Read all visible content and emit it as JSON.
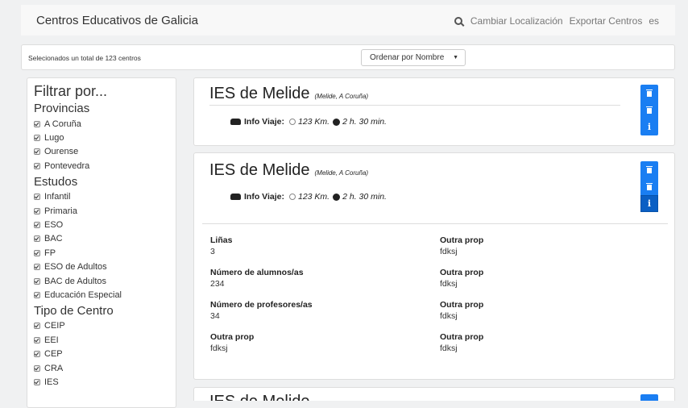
{
  "app": {
    "title": "Centros Educativos de Galicia",
    "nav": {
      "change_location": "Cambiar Localización",
      "export": "Exportar Centros",
      "lang": "es"
    }
  },
  "toolbar": {
    "count_text": "Selecionados un total de 123 centros",
    "sort_value": "Ordenar por Nombre"
  },
  "sidebar": {
    "title": "Filtrar por...",
    "sections": [
      {
        "title": "Provincias",
        "items": [
          "A Coruña",
          "Lugo",
          "Ourense",
          "Pontevedra"
        ]
      },
      {
        "title": "Estudos",
        "items": [
          "Infantil",
          "Primaria",
          "ESO",
          "BAC",
          "FP",
          "ESO de Adultos",
          "BAC de Adultos",
          "Educación Especial"
        ]
      },
      {
        "title": "Tipo de Centro",
        "items": [
          "CEIP",
          "EEI",
          "CEP",
          "CRA",
          "IES"
        ]
      }
    ]
  },
  "cards": [
    {
      "name": "IES de Melide",
      "location": "(Melide, A Coruña)",
      "travel_label": "Info Viaje:",
      "distance": "123 Km.",
      "time": "2 h. 30 min."
    },
    {
      "name": "IES de Melide",
      "location": "(Melide, A Coruña)",
      "travel_label": "Info Viaje:",
      "distance": "123 Km.",
      "time": "2 h. 30 min.",
      "details_left": [
        {
          "label": "Liñas",
          "value": "3"
        },
        {
          "label": "Número de alumnos/as",
          "value": "234"
        },
        {
          "label": "Número de profesores/as",
          "value": "34"
        },
        {
          "label": "Outra prop",
          "value": "fdksj"
        }
      ],
      "details_right": [
        {
          "label": "Outra prop",
          "value": "fdksj"
        },
        {
          "label": "Outra prop",
          "value": "fdksj"
        },
        {
          "label": "Outra prop",
          "value": "fdksj"
        },
        {
          "label": "Outra prop",
          "value": "fdksj"
        }
      ]
    },
    {
      "name": "IES de Melide"
    }
  ],
  "icons": {
    "search": "search-icon",
    "car": "car-icon",
    "clock": "clock-icon",
    "trash": "trash-icon",
    "info": "info-icon",
    "info_glyph": "i"
  },
  "colors": {
    "accent": "#1a7ef2"
  }
}
